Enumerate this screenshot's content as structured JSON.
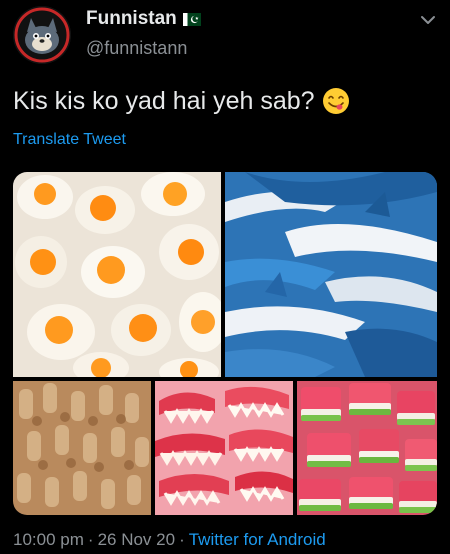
{
  "author": {
    "display_name": "Funnistan",
    "handle": "@funnistann",
    "avatar_icon": "cartoon-cat-avatar-icon",
    "flag_icon": "pakistan-flag-icon"
  },
  "tweet": {
    "text": "Kis kis ko yad hai yeh sab?",
    "emoji_icon": "face-savoring-food-emoji",
    "translate_label": "Translate Tweet"
  },
  "media": {
    "images": [
      {
        "name": "fried-egg-gummies-image"
      },
      {
        "name": "shark-gummies-image"
      },
      {
        "name": "cola-bottle-gummies-image"
      },
      {
        "name": "vampire-teeth-gummies-image"
      },
      {
        "name": "watermelon-slice-gummies-image"
      }
    ]
  },
  "meta": {
    "time": "10:00 pm",
    "date": "26 Nov 20",
    "source": "Twitter for Android"
  },
  "colors": {
    "background": "#000000",
    "link": "#1d9bf0",
    "secondary_text": "#8b9095"
  }
}
